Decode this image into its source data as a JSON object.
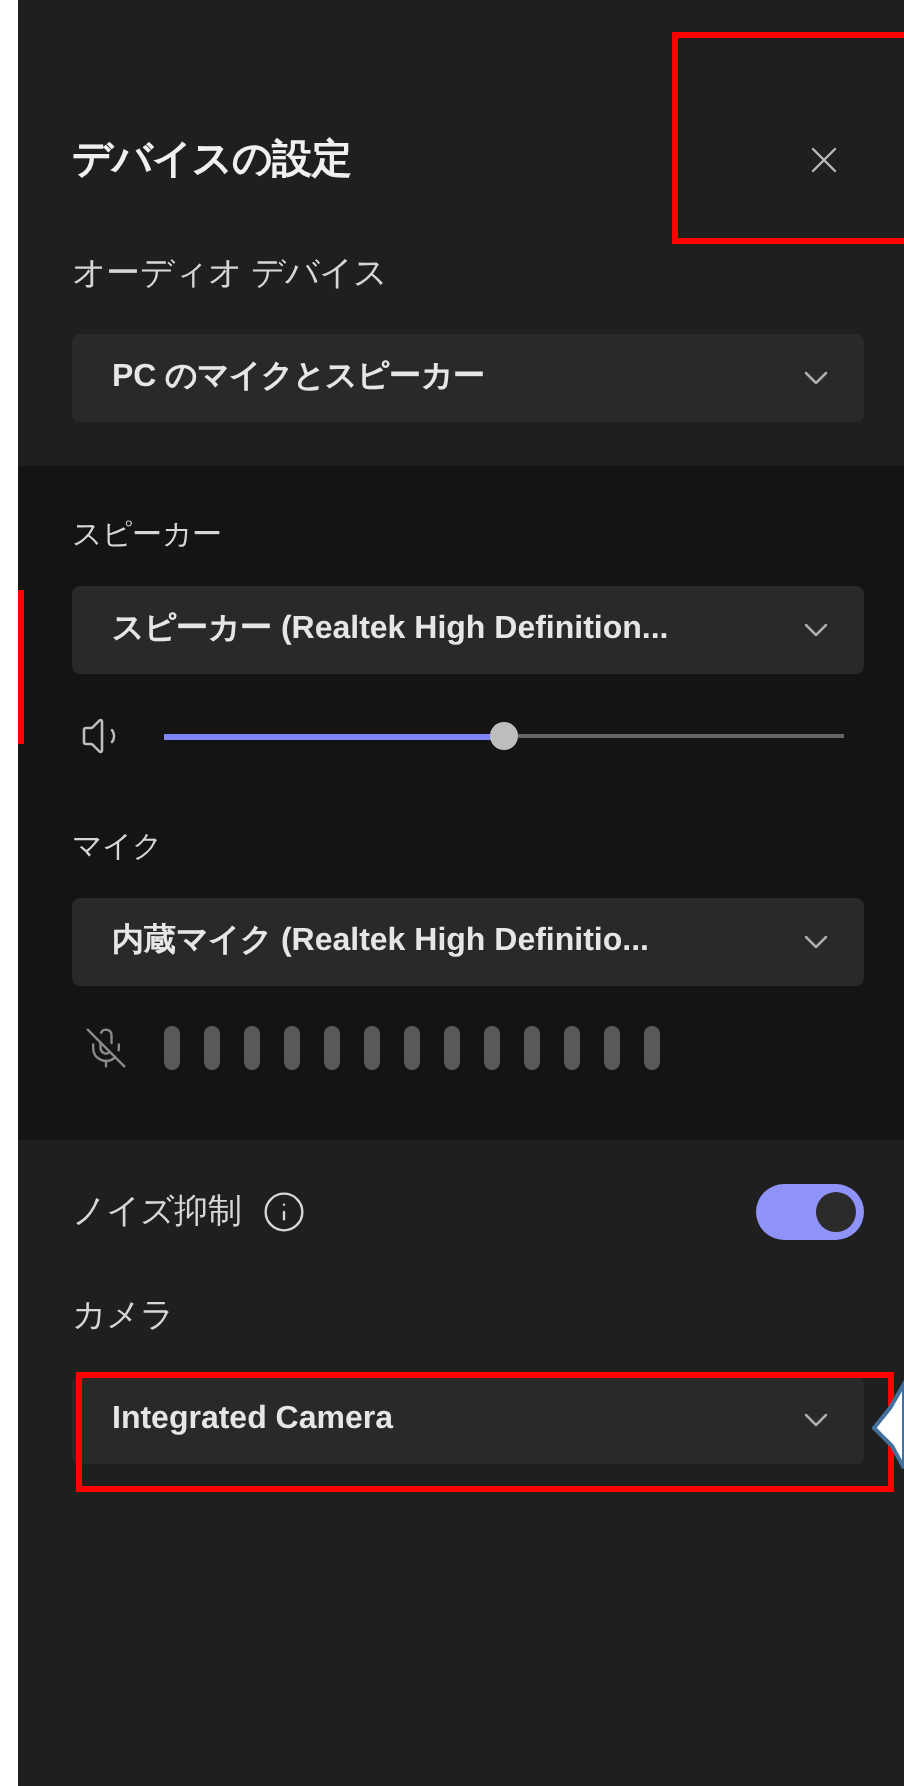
{
  "panel": {
    "title": "デバイスの設定",
    "close_button": {
      "highlighted": true
    }
  },
  "audio_device": {
    "label": "オーディオ デバイス",
    "dropdown": {
      "value": "PC のマイクとスピーカー"
    }
  },
  "speaker": {
    "label": "スピーカー",
    "dropdown": {
      "value": "スピーカー (Realtek High Definition..."
    },
    "volume": {
      "level": 0.5
    },
    "highlighted": true
  },
  "microphone": {
    "label": "マイク",
    "dropdown": {
      "value": "内蔵マイク (Realtek High Definitio..."
    },
    "muted": true
  },
  "noise_suppression": {
    "label": "ノイズ抑制",
    "on": true
  },
  "camera": {
    "label": "カメラ",
    "dropdown": {
      "value": "Integrated Camera",
      "highlighted": true
    },
    "callout": true
  }
}
